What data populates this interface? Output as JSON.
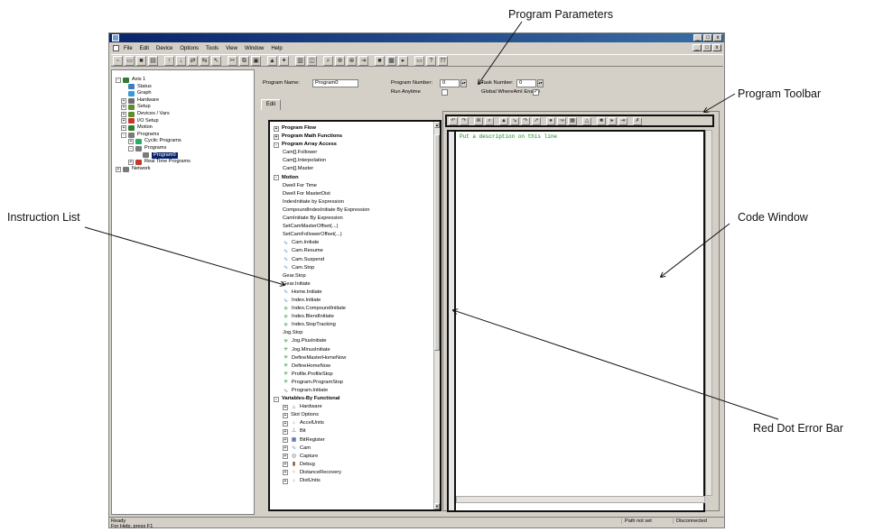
{
  "annotations": {
    "program_parameters": "Program Parameters",
    "program_toolbar": "Program Toolbar",
    "instruction_list": "Instruction List",
    "code_window": "Code Window",
    "red_dot_error_bar": "Red Dot Error Bar"
  },
  "menu": [
    "File",
    "Edit",
    "Device",
    "Options",
    "Tools",
    "View",
    "Window",
    "Help"
  ],
  "window_buttons": [
    "_",
    "□",
    "x"
  ],
  "tree": {
    "items": [
      {
        "label": "Axis 1",
        "icon": "axis-icon",
        "color": "#2e7d32"
      },
      {
        "label": "Status",
        "icon": "status-icon",
        "color": "#3a7fc1"
      },
      {
        "label": "Graph",
        "icon": "graph-icon",
        "color": "#3a9ad9"
      },
      {
        "label": "Hardware",
        "icon": "hardware-icon",
        "color": "#6d6d6d"
      },
      {
        "label": "Setup",
        "icon": "setup-icon",
        "color": "#5b8f2e"
      },
      {
        "label": "Devices / Vars",
        "icon": "devices-icon",
        "color": "#5b8f2e"
      },
      {
        "label": "I/O Setup",
        "icon": "io-icon",
        "color": "#c0392b"
      },
      {
        "label": "Motion",
        "icon": "motion-icon",
        "color": "#2e7d32"
      },
      {
        "label": "Programs",
        "icon": "programs-icon",
        "color": "#7a7a7a"
      },
      {
        "label": "Cyclic Programs",
        "icon": "cyclic-icon",
        "color": "#27ae60"
      },
      {
        "label": "Programs",
        "icon": "programs-icon",
        "color": "#7a7a7a"
      },
      {
        "label": "Program0",
        "icon": "program-icon",
        "color": "#7a7a7a"
      },
      {
        "label": "Real Time Programs",
        "icon": "realtime-icon",
        "color": "#c0392b"
      },
      {
        "label": "Network",
        "icon": "network-icon",
        "color": "#7a7a7a"
      }
    ]
  },
  "params": {
    "program_name_label": "Program Name:",
    "program_name_value": "Program0",
    "program_number_label": "Program Number:",
    "program_number_value": "0",
    "task_number_label": "Task Number:",
    "task_number_value": "0",
    "run_anytime_label": "Run Anytime",
    "global_where_label": "Global WhereAmI Enable",
    "global_where_check": "✓",
    "tab_edit": "Edit"
  },
  "instructions": [
    {
      "label": "Program Flow",
      "bold": true,
      "pm": "+"
    },
    {
      "label": "Program Math Functions",
      "bold": true,
      "pm": "+"
    },
    {
      "label": "Program Array Access",
      "bold": true,
      "pm": "-"
    },
    {
      "label": "Cam[].Follower",
      "indent": 1
    },
    {
      "label": "Cam[].Interpolation",
      "indent": 1
    },
    {
      "label": "Cam[].Master",
      "indent": 1
    },
    {
      "label": "Motion",
      "bold": true,
      "pm": "-"
    },
    {
      "label": "Dwell For Time",
      "indent": 1
    },
    {
      "label": "Dwell For MasterDist",
      "indent": 1
    },
    {
      "label": "IndexInitiate by Expression",
      "indent": 1
    },
    {
      "label": "CompoundIndexInitiate By Expression",
      "indent": 1
    },
    {
      "label": "CamInitiate By Expression",
      "indent": 1
    },
    {
      "label": "SetCamMasterOffset(...)",
      "indent": 1
    },
    {
      "label": "SetCamFollowerOffset(...)",
      "indent": 1
    },
    {
      "label": "Cam.Initiate",
      "indent": 1,
      "icon": "cam"
    },
    {
      "label": "Cam.Resume",
      "indent": 1,
      "icon": "cam"
    },
    {
      "label": "Cam.Suspend",
      "indent": 1,
      "icon": "cam"
    },
    {
      "label": "Cam.Stop",
      "indent": 1,
      "icon": "cam"
    },
    {
      "label": "Gear.Stop",
      "indent": 1
    },
    {
      "label": "Gear.Initiate",
      "indent": 1
    },
    {
      "label": "Home.Initiate",
      "indent": 1,
      "icon": "cam"
    },
    {
      "label": "Index.Initiate",
      "indent": 1,
      "icon": "cam"
    },
    {
      "label": "Index.CompoundInitiate",
      "indent": 1,
      "icon": "star"
    },
    {
      "label": "Index.BlendInitiate",
      "indent": 1,
      "icon": "star"
    },
    {
      "label": "Index.StopTracking",
      "indent": 1,
      "icon": "star"
    },
    {
      "label": "Jog.Stop",
      "indent": 1
    },
    {
      "label": "Jog.PlusInitiate",
      "indent": 1,
      "icon": "star"
    },
    {
      "label": "Jog.MinusInitiate",
      "indent": 1,
      "icon": "star"
    },
    {
      "label": "DefineMasterHomeNow",
      "indent": 1,
      "icon": "star"
    },
    {
      "label": "DefineHomeNow",
      "indent": 1,
      "icon": "star"
    },
    {
      "label": "Profile.ProfileStop",
      "indent": 1,
      "icon": "star"
    },
    {
      "label": "Program.ProgramStop",
      "indent": 1,
      "icon": "star"
    },
    {
      "label": "Program.Initiate",
      "indent": 1,
      "icon": "cam"
    },
    {
      "label": "Variables-By Functional",
      "bold": true,
      "pm": "-"
    },
    {
      "label": "Hardware",
      "indent": 1,
      "pm": "+",
      "icon": "hw"
    },
    {
      "label": "Slot Options",
      "indent": 1,
      "pm": "+"
    },
    {
      "label": "AccelUnits",
      "indent": 1,
      "pm": "+",
      "icon": "bulb"
    },
    {
      "label": "Bit",
      "indent": 1,
      "pm": "+",
      "icon": "bit"
    },
    {
      "label": "BitRegister",
      "indent": 1,
      "pm": "+",
      "icon": "reg"
    },
    {
      "label": "Cam",
      "indent": 1,
      "pm": "+",
      "icon": "cam"
    },
    {
      "label": "Capture",
      "indent": 1,
      "pm": "+",
      "icon": "cap"
    },
    {
      "label": "Debug",
      "indent": 1,
      "pm": "+",
      "icon": "dbg"
    },
    {
      "label": "DistanceRecovery",
      "indent": 1,
      "pm": "+",
      "icon": "bulb"
    },
    {
      "label": "DistUnits",
      "indent": 1,
      "pm": "+",
      "icon": "bulb"
    }
  ],
  "code": {
    "line1": "Put a description on this line"
  },
  "status": {
    "ready": "Ready",
    "path": "Path not set",
    "conn": "Disconnected",
    "help": "For Help, press F1"
  }
}
